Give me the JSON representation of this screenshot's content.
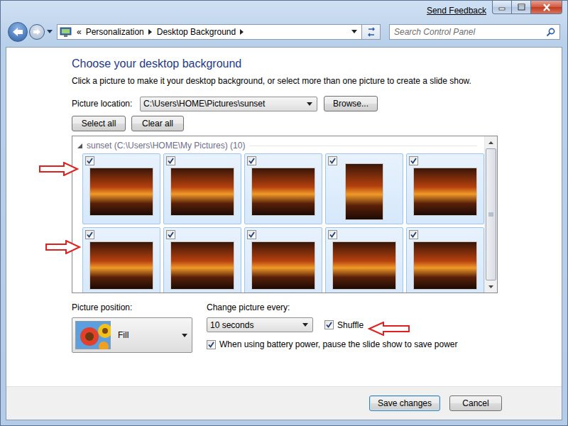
{
  "window": {
    "feedback": "Send Feedback"
  },
  "address": {
    "chevron": "«",
    "crumbs": [
      "Personalization",
      "Desktop Background"
    ]
  },
  "search": {
    "placeholder": "Search Control Panel"
  },
  "page": {
    "title": "Choose your desktop background",
    "description": "Click a picture to make it your desktop background, or select more than one picture to create a slide show."
  },
  "location": {
    "label": "Picture location:",
    "value": "C:\\Users\\HOME\\Pictures\\sunset",
    "browse": "Browse..."
  },
  "selection_buttons": [
    "Select all",
    "Clear all"
  ],
  "gallery": {
    "group": "sunset (C:\\Users\\HOME\\My Pictures) (10)",
    "expanded": true,
    "pictures": [
      {
        "kind": "landscape",
        "checked": true,
        "selected": true
      },
      {
        "kind": "landscape",
        "checked": true,
        "selected": true
      },
      {
        "kind": "landscape",
        "checked": true,
        "selected": true
      },
      {
        "kind": "portrait",
        "checked": true,
        "selected": true
      },
      {
        "kind": "landscape",
        "checked": true,
        "selected": true
      },
      {
        "kind": "landscape",
        "checked": true,
        "selected": true
      },
      {
        "kind": "landscape",
        "checked": true,
        "selected": true
      },
      {
        "kind": "landscape",
        "checked": true,
        "selected": true
      },
      {
        "kind": "landscape",
        "checked": true,
        "selected": true
      },
      {
        "kind": "landscape",
        "checked": true,
        "selected": true
      }
    ]
  },
  "position": {
    "label": "Picture position:",
    "value": "Fill"
  },
  "interval": {
    "label": "Change picture every:",
    "value": "10 seconds"
  },
  "checkboxes": [
    {
      "label": "Shuffle",
      "checked": true
    },
    {
      "label": "When using battery power, pause the slide show to save power",
      "checked": true
    }
  ],
  "buttons": [
    {
      "label": "Save changes",
      "default": true
    },
    {
      "label": "Cancel",
      "default": false
    }
  ]
}
